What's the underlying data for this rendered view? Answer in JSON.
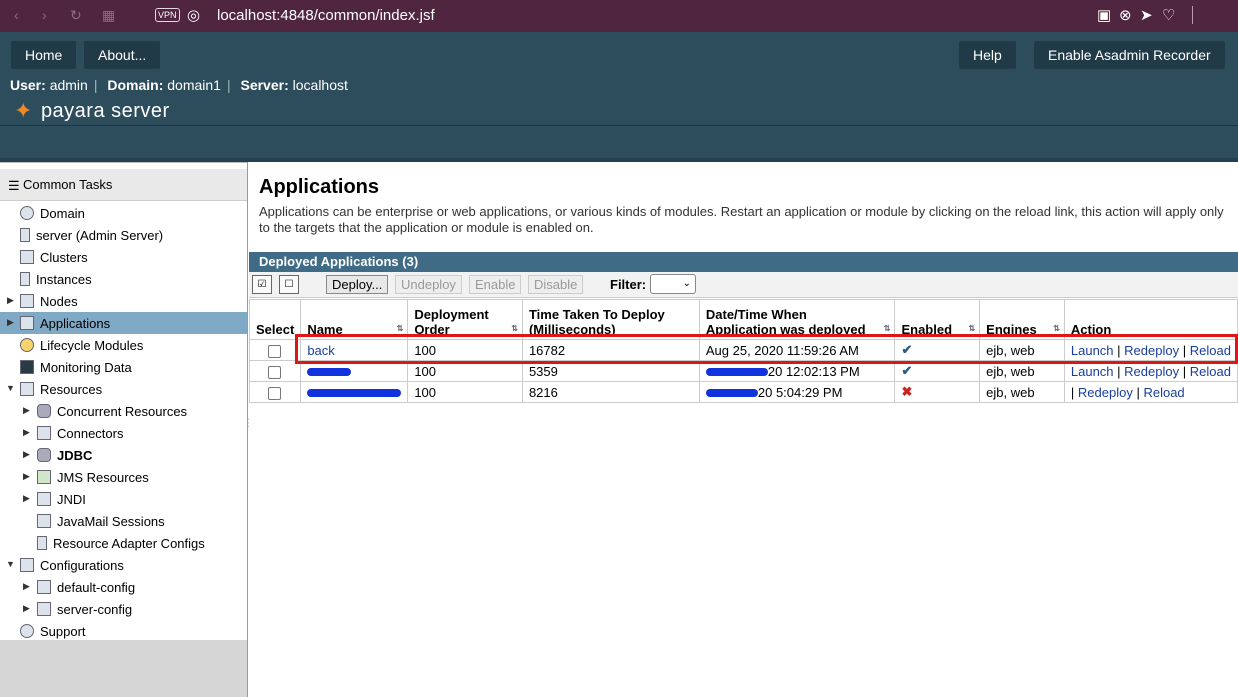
{
  "browser": {
    "vpn_label": "VPN",
    "url": "localhost:4848/common/index.jsf"
  },
  "masthead": {
    "home": "Home",
    "about": "About...",
    "help": "Help",
    "recorder": "Enable Asadmin Recorder",
    "user_label": "User:",
    "user": "admin",
    "domain_label": "Domain:",
    "domain": "domain1",
    "server_label": "Server:",
    "server": "localhost",
    "logo_text": "payara server"
  },
  "sidebar": {
    "header": "Common Tasks",
    "items": [
      {
        "label": "Domain"
      },
      {
        "label": "server (Admin Server)"
      },
      {
        "label": "Clusters"
      },
      {
        "label": "Instances"
      },
      {
        "label": "Nodes"
      },
      {
        "label": "Applications"
      },
      {
        "label": "Lifecycle Modules"
      },
      {
        "label": "Monitoring Data"
      },
      {
        "label": "Resources"
      },
      {
        "label": "Concurrent Resources"
      },
      {
        "label": "Connectors"
      },
      {
        "label": "JDBC"
      },
      {
        "label": "JMS Resources"
      },
      {
        "label": "JNDI"
      },
      {
        "label": "JavaMail Sessions"
      },
      {
        "label": "Resource Adapter Configs"
      },
      {
        "label": "Configurations"
      },
      {
        "label": "default-config"
      },
      {
        "label": "server-config"
      },
      {
        "label": "Support"
      }
    ]
  },
  "main": {
    "title": "Applications",
    "description": "Applications can be enterprise or web applications, or various kinds of modules. Restart an application or module by clicking on the reload link, this action will apply only to the targets that the application or module is enabled on.",
    "table_title": "Deployed Applications (3)",
    "toolbar": {
      "deploy": "Deploy...",
      "undeploy": "Undeploy",
      "enable": "Enable",
      "disable": "Disable",
      "filter": "Filter:"
    },
    "columns": {
      "select": "Select",
      "name": "Name",
      "order_1": "Deployment",
      "order_2": "Order",
      "time_1": "Time Taken To Deploy",
      "time_2": "(Milliseconds)",
      "date_1": "Date/Time When",
      "date_2": "Application was deployed",
      "enabled": "Enabled",
      "engines": "Engines",
      "action": "Action"
    },
    "rows": [
      {
        "name": "back",
        "order": "100",
        "time": "16782",
        "date": "Aug 25, 2020 11:59:26 AM",
        "engines": "ejb, web",
        "launch": "Launch",
        "redeploy": "Redeploy",
        "reload": "Reload"
      },
      {
        "name": "",
        "order": "100",
        "time": "5359",
        "date": "20 12:02:13 PM",
        "engines": "ejb, web",
        "launch": "Launch",
        "redeploy": "Redeploy",
        "reload": "Reload"
      },
      {
        "name": "",
        "order": "100",
        "time": "8216",
        "date": "20 5:04:29 PM",
        "engines": "ejb, web",
        "redeploy": "Redeploy",
        "reload": "Reload"
      }
    ],
    "action_sep": "|"
  },
  "colors": {
    "browser_bar": "#4f2540",
    "masthead": "#2d4c5c",
    "table_header": "#3f6b86",
    "selected_nav": "#7fa9c4",
    "highlight_box": "#e01515",
    "link": "#1a3e9e"
  }
}
